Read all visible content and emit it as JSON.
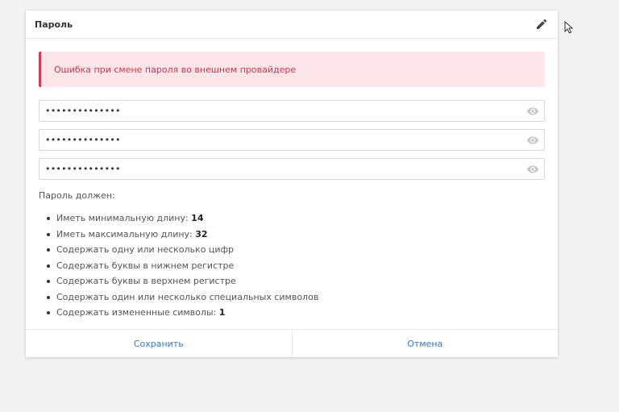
{
  "card": {
    "title": "Пароль",
    "edit_icon": "pencil-icon"
  },
  "alert": {
    "message": "Ошибка при смене пароля во внешнем провайдере",
    "color": "#c8364c"
  },
  "fields": [
    {
      "value": "••••••••••••••",
      "icon": "eye-icon"
    },
    {
      "value": "••••••••••••••",
      "icon": "eye-icon"
    },
    {
      "value": "••••••••••••••",
      "icon": "eye-icon"
    }
  ],
  "rules": {
    "title": "Пароль должен:",
    "items": [
      {
        "text": "Иметь минимальную длину: ",
        "value": "14"
      },
      {
        "text": "Иметь максимальную длину: ",
        "value": "32"
      },
      {
        "text": "Содержать одну или несколько цифр",
        "value": ""
      },
      {
        "text": "Содержать буквы в нижнем регистре",
        "value": ""
      },
      {
        "text": "Содержать буквы в верхнем регистре",
        "value": ""
      },
      {
        "text": "Содержать один или несколько специальных символов",
        "value": ""
      },
      {
        "text": "Содержать измененные символы: ",
        "value": "1"
      }
    ]
  },
  "footer": {
    "save_label": "Сохранить",
    "cancel_label": "Отмена",
    "link_color": "#3a78c2"
  }
}
